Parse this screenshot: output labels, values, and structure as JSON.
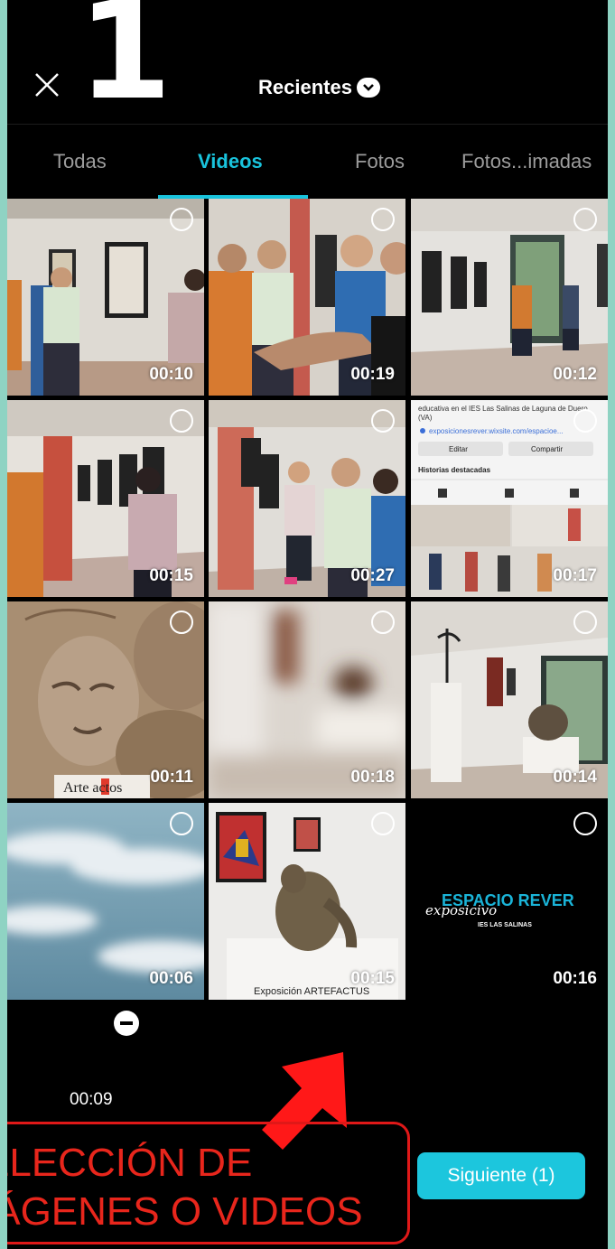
{
  "header": {
    "step_number": "1",
    "album_title": "Recientes"
  },
  "tabs": [
    {
      "label": "Todas",
      "active": false
    },
    {
      "label": "Videos",
      "active": true
    },
    {
      "label": "Fotos",
      "active": false
    },
    {
      "label": "Fotos...imadas",
      "active": false
    }
  ],
  "videos": [
    {
      "duration": "00:10"
    },
    {
      "duration": "00:19"
    },
    {
      "duration": "00:12"
    },
    {
      "duration": "00:15"
    },
    {
      "duration": "00:27"
    },
    {
      "duration": "00:17"
    },
    {
      "duration": "00:11"
    },
    {
      "duration": "00:18"
    },
    {
      "duration": "00:14"
    },
    {
      "duration": "00:06"
    },
    {
      "duration": "00:15"
    },
    {
      "duration": "00:16"
    }
  ],
  "thumb_text": {
    "artefactos_logo": "Arte  actos",
    "exposicion_caption": "Exposición ARTEFACTUS",
    "espacio_rever": "ESPACIO REVER",
    "espacio_rever_script": "exposicivo",
    "ies": "IES LAS SALINAS",
    "web_line1": "educativa en el IES Las Salinas de Laguna de Duero",
    "web_line2": "(VA)",
    "web_url": "exposicionesrever.wixsite.com/espacioe...",
    "web_edit": "Editar",
    "web_share": "Compartir",
    "web_highlights": "Historias destacadas"
  },
  "selected": {
    "duration": "00:09"
  },
  "annotation": {
    "line1": "ELECCIÓN DE",
    "line2": "IÁGENES O VIDEOS"
  },
  "next_button": {
    "label": "Siguiente (1)"
  },
  "colors": {
    "accent": "#19c3dc",
    "annotation_red": "#e8261c",
    "frame": "#8fd3c3"
  }
}
